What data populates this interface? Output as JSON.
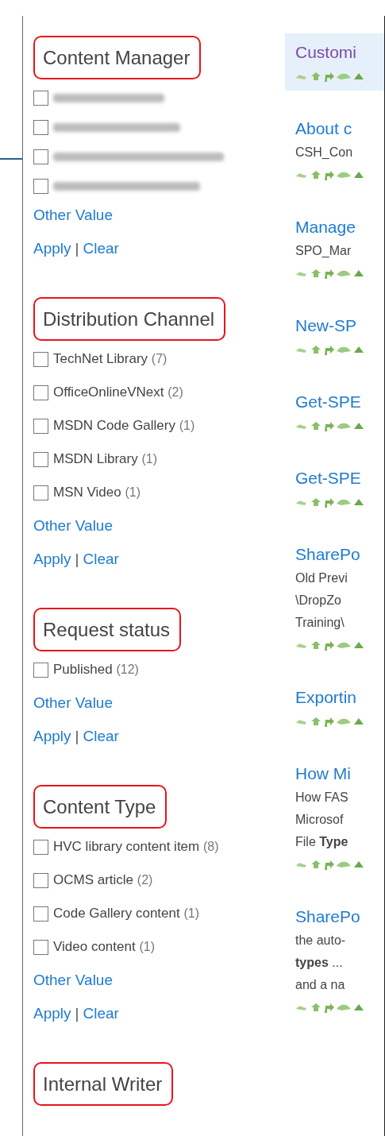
{
  "refiners": [
    {
      "title": "Content Manager",
      "items": [
        {
          "kind": "redacted",
          "checked": false
        },
        {
          "kind": "redacted",
          "checked": false
        },
        {
          "kind": "redacted",
          "checked": false
        },
        {
          "kind": "redacted",
          "checked": false
        }
      ],
      "other": "Other Value",
      "apply": "Apply",
      "separator": "|",
      "clear": "Clear"
    },
    {
      "title": "Distribution Channel",
      "items": [
        {
          "kind": "text",
          "label": "TechNet Library",
          "count": "(7)",
          "checked": false
        },
        {
          "kind": "text",
          "label": "OfficeOnlineVNext",
          "count": "(2)",
          "checked": false
        },
        {
          "kind": "text",
          "label": "MSDN Code Gallery",
          "count": "(1)",
          "checked": false
        },
        {
          "kind": "text",
          "label": "MSDN Library",
          "count": "(1)",
          "checked": false
        },
        {
          "kind": "text",
          "label": "MSN Video",
          "count": "(1)",
          "checked": false
        }
      ],
      "other": "Other Value",
      "apply": "Apply",
      "separator": "|",
      "clear": "Clear"
    },
    {
      "title": "Request status",
      "items": [
        {
          "kind": "text",
          "label": "Published",
          "count": "(12)",
          "checked": false
        }
      ],
      "other": "Other Value",
      "apply": "Apply",
      "separator": "|",
      "clear": "Clear"
    },
    {
      "title": "Content Type",
      "items": [
        {
          "kind": "text",
          "label": "HVC library content item",
          "count": "(8)",
          "checked": false
        },
        {
          "kind": "text",
          "label": "OCMS article",
          "count": "(2)",
          "checked": false
        },
        {
          "kind": "text",
          "label": "Code Gallery content",
          "count": "(1)",
          "checked": false
        },
        {
          "kind": "text",
          "label": "Video content",
          "count": "(1)",
          "checked": false
        }
      ],
      "other": "Other Value",
      "apply": "Apply",
      "separator": "|",
      "clear": "Clear"
    },
    {
      "title": "Internal Writer"
    }
  ],
  "results": [
    {
      "title": "Customi",
      "visited": true,
      "selected": true
    },
    {
      "title": "About c",
      "visited": false,
      "selected": false,
      "lines": [
        "CSH_Con"
      ]
    },
    {
      "title": "Manage",
      "visited": false,
      "selected": false,
      "lines": [
        "SPO_Mar"
      ]
    },
    {
      "title": "New-SP",
      "visited": false,
      "selected": false
    },
    {
      "title": "Get-SPE",
      "visited": false,
      "selected": false
    },
    {
      "title": "Get-SPE",
      "visited": false,
      "selected": false
    },
    {
      "title": "SharePo",
      "visited": false,
      "selected": false,
      "lines": [
        "Old Previ",
        "\\DropZo",
        "Training\\"
      ]
    },
    {
      "title": "Exportin",
      "visited": false,
      "selected": false
    },
    {
      "title": "How Mi",
      "visited": false,
      "selected": false,
      "lines": [
        "How FAS",
        "Microsof",
        "File **Type**"
      ]
    },
    {
      "title": "SharePo",
      "visited": false,
      "selected": false,
      "lines": [
        "the auto-",
        "**types** ...",
        "and a na"
      ]
    }
  ]
}
